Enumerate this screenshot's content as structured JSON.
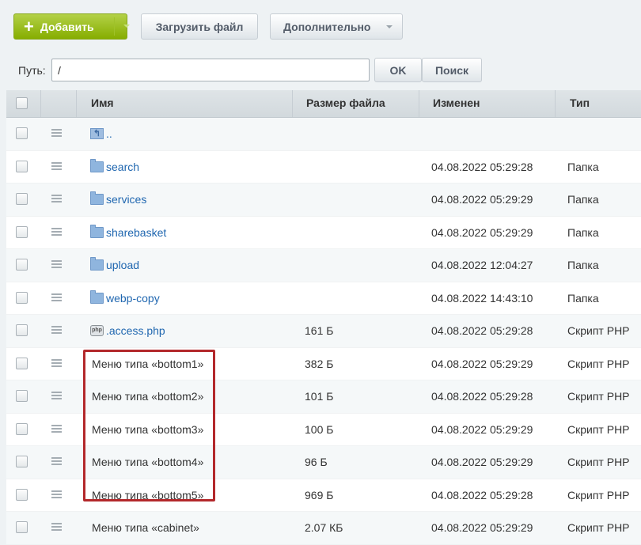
{
  "toolbar": {
    "add_label": "Добавить",
    "upload_label": "Загрузить файл",
    "more_label": "Дополнительно"
  },
  "pathbar": {
    "label": "Путь:",
    "value": "/",
    "ok_label": "OK",
    "search_label": "Поиск"
  },
  "table": {
    "columns": [
      "Имя",
      "Размер файла",
      "Изменен",
      "Тип"
    ],
    "rows": [
      {
        "name": "..",
        "icon": "parent-folder-icon",
        "size": "",
        "modified": "",
        "type": ""
      },
      {
        "name": "search",
        "icon": "folder-icon",
        "size": "",
        "modified": "04.08.2022 05:29:28",
        "type": "Папка"
      },
      {
        "name": "services",
        "icon": "folder-icon",
        "size": "",
        "modified": "04.08.2022 05:29:29",
        "type": "Папка"
      },
      {
        "name": "sharebasket",
        "icon": "folder-icon",
        "size": "",
        "modified": "04.08.2022 05:29:29",
        "type": "Папка"
      },
      {
        "name": "upload",
        "icon": "folder-icon",
        "size": "",
        "modified": "04.08.2022 12:04:27",
        "type": "Папка"
      },
      {
        "name": "webp-copy",
        "icon": "folder-icon",
        "size": "",
        "modified": "04.08.2022 14:43:10",
        "type": "Папка"
      },
      {
        "name": ".access.php",
        "icon": "php-file-icon",
        "size": "161 Б",
        "modified": "04.08.2022 05:29:28",
        "type": "Скрипт PHP"
      },
      {
        "name": "Меню типа «bottom1»",
        "icon": "",
        "size": "382 Б",
        "modified": "04.08.2022 05:29:29",
        "type": "Скрипт PHP"
      },
      {
        "name": "Меню типа «bottom2»",
        "icon": "",
        "size": "101 Б",
        "modified": "04.08.2022 05:29:28",
        "type": "Скрипт PHP"
      },
      {
        "name": "Меню типа «bottom3»",
        "icon": "",
        "size": "100 Б",
        "modified": "04.08.2022 05:29:29",
        "type": "Скрипт PHP"
      },
      {
        "name": "Меню типа «bottom4»",
        "icon": "",
        "size": "96 Б",
        "modified": "04.08.2022 05:29:29",
        "type": "Скрипт PHP"
      },
      {
        "name": "Меню типа «bottom5»",
        "icon": "",
        "size": "969 Б",
        "modified": "04.08.2022 05:29:28",
        "type": "Скрипт PHP"
      },
      {
        "name": "Меню типа «cabinet»",
        "icon": "",
        "size": "2.07 КБ",
        "modified": "04.08.2022 05:29:29",
        "type": "Скрипт PHP"
      }
    ]
  },
  "colors": {
    "add_button": "#86ad00",
    "link": "#2067b0",
    "highlight_border": "#b3282b"
  }
}
